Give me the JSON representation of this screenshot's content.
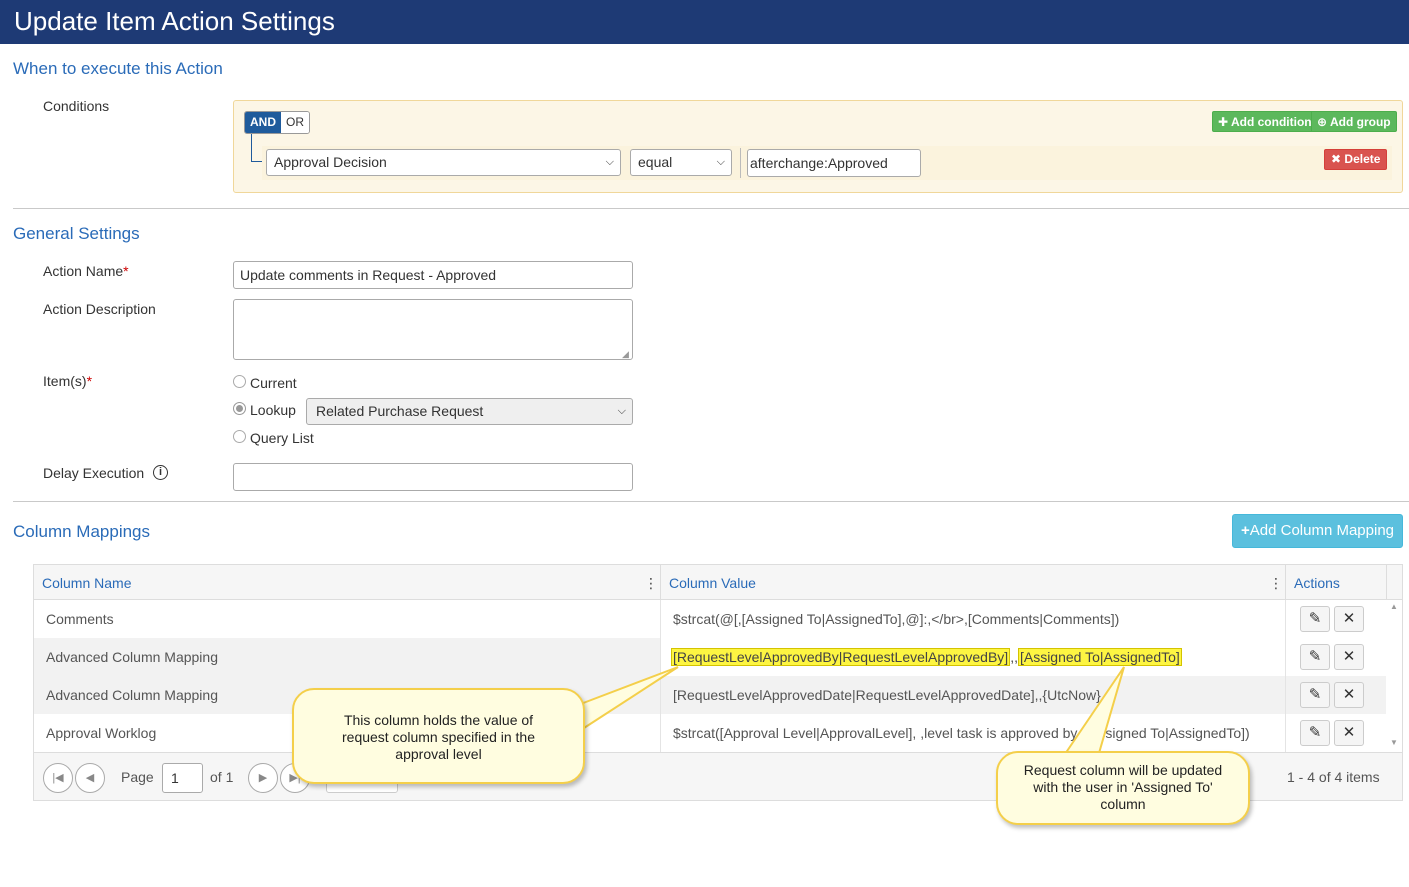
{
  "page": {
    "title": "Update Item Action Settings"
  },
  "when_section": {
    "title": "When to execute this Action",
    "conditions_label": "Conditions",
    "and_label": "AND",
    "or_label": "OR",
    "add_condition_label": "Add condition",
    "add_group_label": "Add group",
    "rule": {
      "field": "Approval Decision",
      "operator": "equal",
      "value": "afterchange:Approved",
      "delete_label": "Delete"
    }
  },
  "general_section": {
    "title": "General Settings",
    "action_name_label": "Action Name",
    "action_name_value": "Update comments in Request - Approved",
    "action_description_label": "Action Description",
    "action_description_value": "",
    "items_label": "Item(s)",
    "item_options": [
      "Current",
      "Lookup",
      "Query List"
    ],
    "selected_item_option": "Lookup",
    "lookup_value": "Related Purchase Request",
    "delay_label": "Delay Execution",
    "delay_value": ""
  },
  "mappings_section": {
    "title": "Column Mappings",
    "add_button_label": "Add Column Mapping",
    "columns": [
      "Column Name",
      "Column Value",
      "Actions"
    ],
    "rows": [
      {
        "name": "Comments",
        "value": "$strcat(@[,[Assigned To|AssignedTo],@]:,</br>,[Comments|Comments])"
      },
      {
        "name": "Advanced Column Mapping",
        "value_part1": "[RequestLevelApprovedBy|RequestLevelApprovedBy]",
        "value_sep": ",,",
        "value_part2": "[Assigned To|AssignedTo]"
      },
      {
        "name": "Advanced Column Mapping",
        "value": "[RequestLevelApprovedDate|RequestLevelApprovedDate],,{UtcNow}"
      },
      {
        "name": "Approval Worklog",
        "value": "$strcat([Approval Level|ApprovalLevel], ,level task is approved by ,[Assigned To|AssignedTo])"
      }
    ],
    "pager": {
      "page_label": "Page",
      "page_value": "1",
      "of_label": "of 1",
      "summary": "1 - 4 of 4 items"
    }
  },
  "callouts": {
    "left": "This column holds the value of request column specified in the approval level",
    "right": "Request column will be updated with the user in 'Assigned To' column"
  },
  "colors": {
    "title_bar": "#1e3a75",
    "section_title": "#2a6bb8",
    "highlight": "#fdf542",
    "callout_fill": "#fffde0",
    "callout_border": "#f4cf4a"
  }
}
